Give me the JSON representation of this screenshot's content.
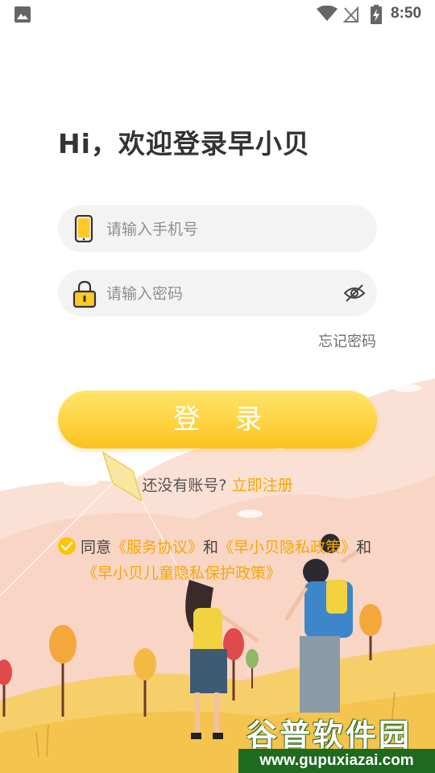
{
  "status_bar": {
    "time": "8:50",
    "icons": [
      "gallery-icon",
      "wifi-icon",
      "no-signal-icon",
      "battery-charging-icon"
    ]
  },
  "login": {
    "title": "Hi，欢迎登录早小贝",
    "phone_placeholder": "请输入手机号",
    "password_placeholder": "请输入密码",
    "forgot_password": "忘记密码",
    "login_button": "登 录",
    "no_account_prompt": "还没有账号?",
    "register_link": "立即注册"
  },
  "agreement": {
    "prefix": "同意",
    "service_agreement": "《服务协议》",
    "and1": "和",
    "privacy_policy": "《早小贝隐私政策》",
    "and2": "和",
    "child_privacy_policy": "《早小贝儿童隐私保护政策》",
    "checked": true
  },
  "watermark": {
    "title": "谷普软件园",
    "url": "www.gupuxiazai.com"
  },
  "colors": {
    "accent": "#f5a800",
    "button_top": "#ffe46b",
    "button_bottom": "#fbc21e",
    "field_bg": "#f3f3f3",
    "hill_pink": "#f9d5c6",
    "hill_yellow": "#f5c44e"
  }
}
